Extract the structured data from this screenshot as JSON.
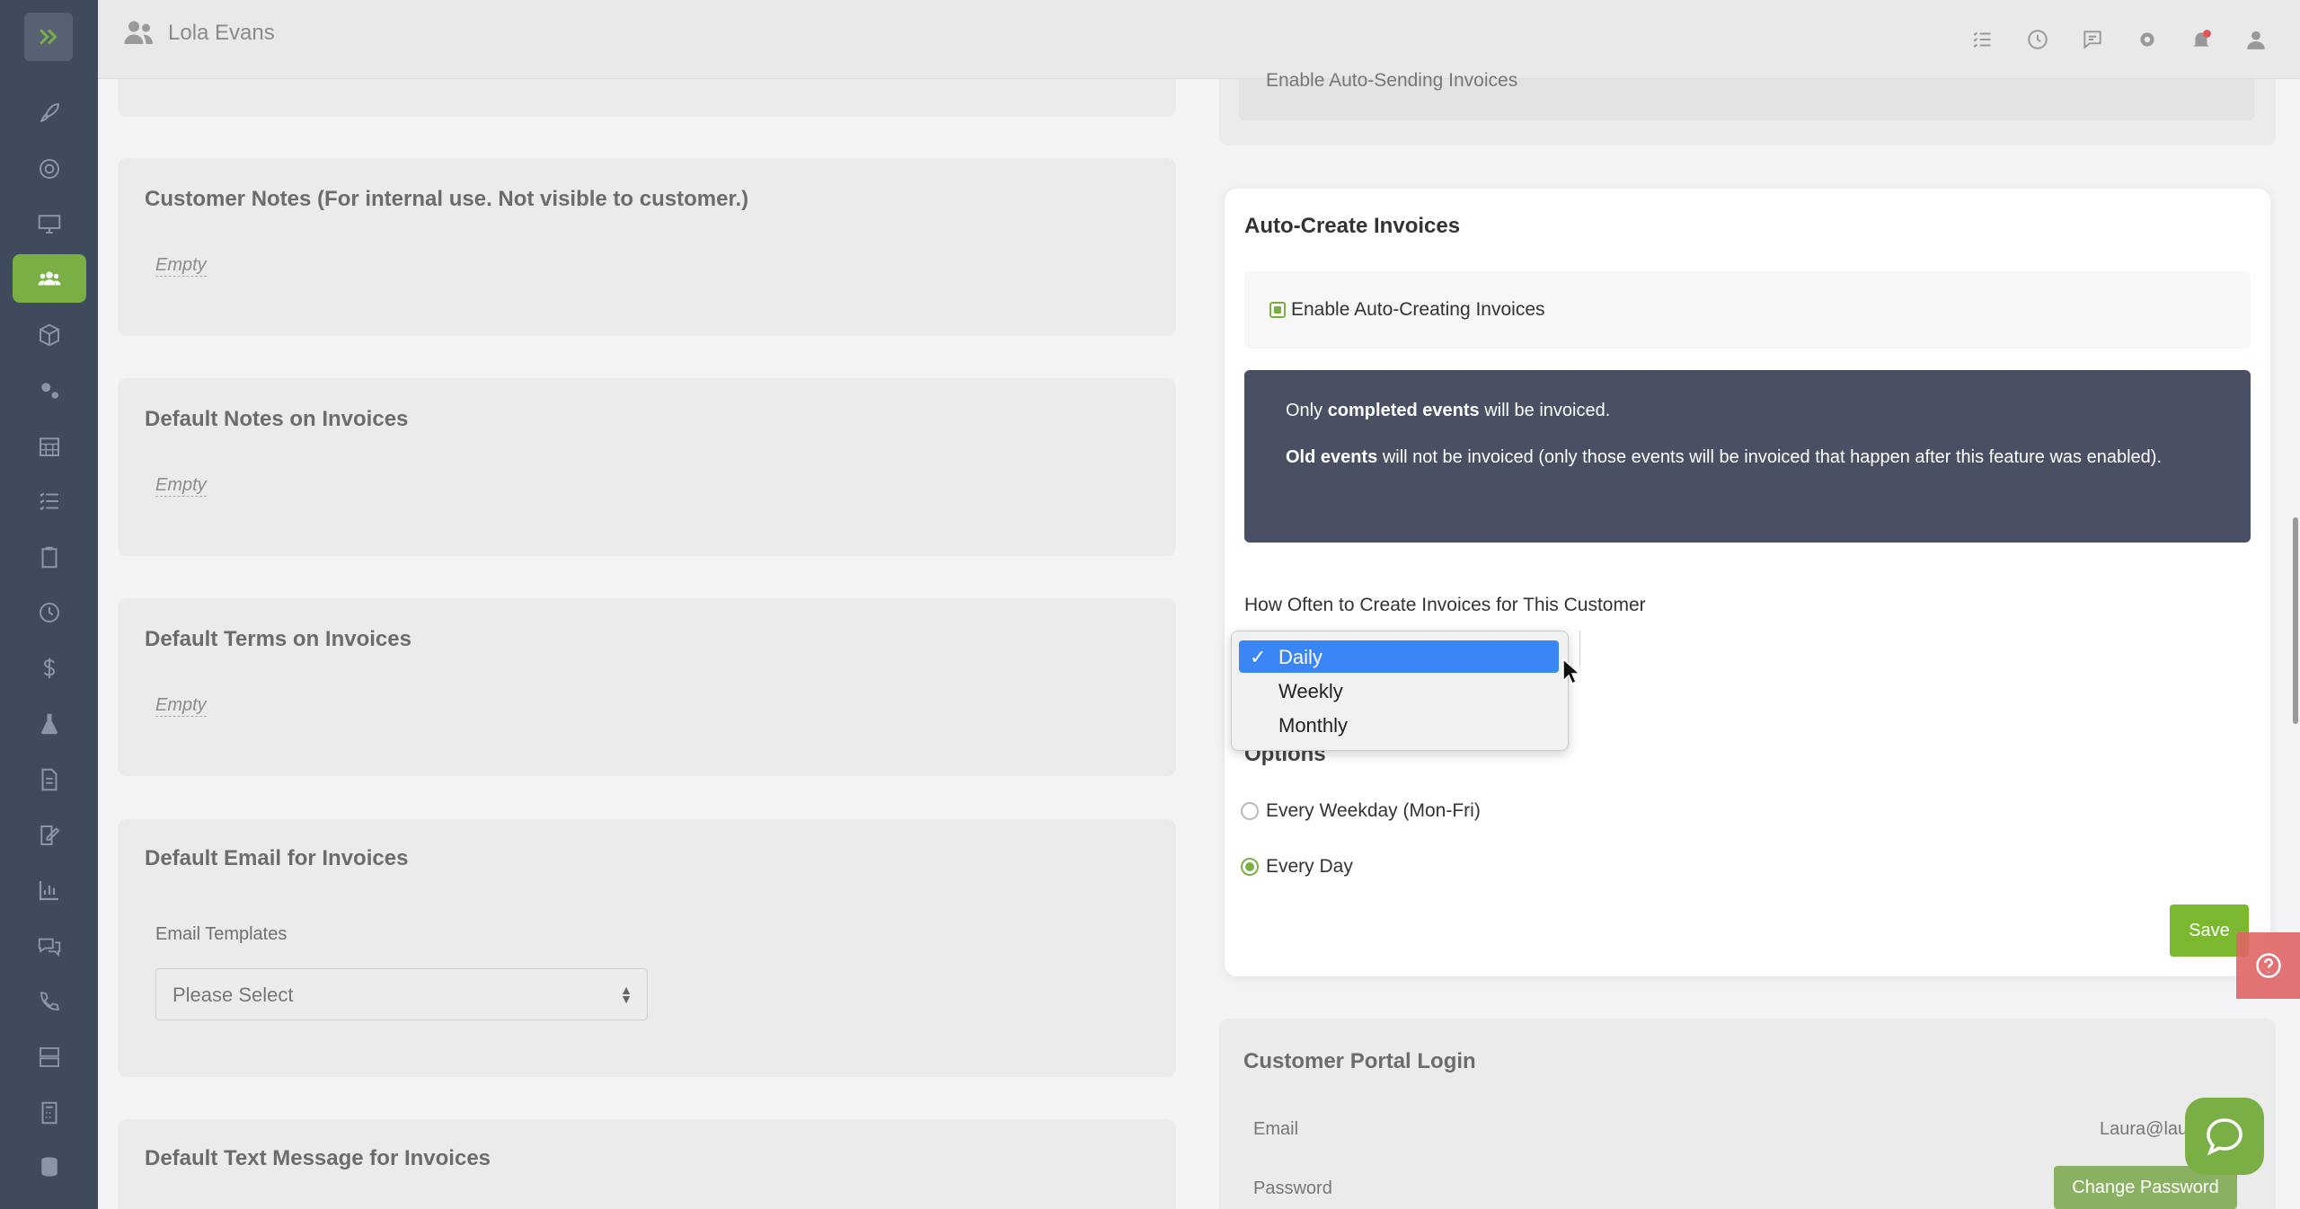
{
  "header": {
    "user_name": "Lola Evans"
  },
  "left": {
    "customer_notes": {
      "title": "Customer Notes (For internal use. Not visible to customer.)",
      "value": "Empty"
    },
    "default_notes": {
      "title": "Default Notes on Invoices",
      "value": "Empty"
    },
    "default_terms": {
      "title": "Default Terms on Invoices",
      "value": "Empty"
    },
    "default_email": {
      "title": "Default Email for Invoices",
      "templates_label": "Email Templates",
      "select_value": "Please Select"
    },
    "default_text": {
      "title": "Default Text Message for Invoices"
    }
  },
  "right": {
    "auto_send_partial": "Enable Auto-Sending Invoices",
    "auto_create": {
      "title": "Auto-Create Invoices",
      "enable_label": "Enable Auto-Creating Invoices",
      "info_line1_pre": "Only ",
      "info_line1_bold": "completed events",
      "info_line1_post": " will be invoiced.",
      "info_line2_bold": "Old events",
      "info_line2_post": " will not be invoiced (only those events will be invoiced that happen after this feature was enabled).",
      "frequency_label": "How Often to Create Invoices for This Customer",
      "frequency_options": [
        "Daily",
        "Weekly",
        "Monthly"
      ],
      "frequency_selected": "Daily",
      "options_title": "Options",
      "option_weekday": "Every Weekday (Mon-Fri)",
      "option_everyday": "Every Day",
      "save_label": "Save"
    },
    "portal": {
      "title": "Customer Portal Login",
      "email_label": "Email",
      "email_value": "Laura@lau",
      "password_label": "Password",
      "change_password_label": "Change Password"
    }
  },
  "colors": {
    "accent": "#7aaf45",
    "sidebar": "#3f4a5c",
    "info_bg": "#4a5064",
    "selected_option": "#3b86f6"
  }
}
